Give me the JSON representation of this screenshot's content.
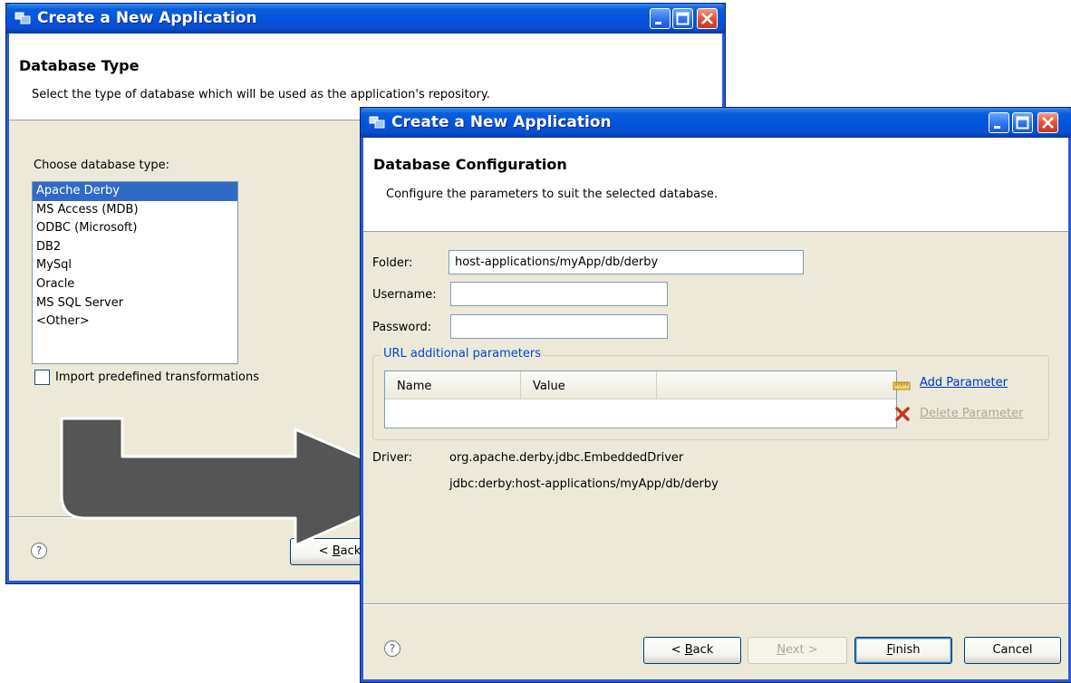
{
  "back_window": {
    "title": "Create a New Application",
    "header_title": "Database Type",
    "header_desc": "Select the type of database which will be used as the application's repository.",
    "choose_label": "Choose database type:",
    "db_types": [
      "Apache Derby",
      "MS Access (MDB)",
      "ODBC (Microsoft)",
      "DB2",
      "MySql",
      "Oracle",
      "MS SQL Server",
      "<Other>"
    ],
    "selected_index": 0,
    "import_checkbox_label": "Import predefined transformations",
    "back_button": {
      "mnemonic": "B",
      "rest": "ack",
      "prefix": "< "
    }
  },
  "front_window": {
    "title": "Create a New Application",
    "header_title": "Database Configuration",
    "header_desc": "Configure the parameters to suit the selected database.",
    "folder_label": "Folder:",
    "folder_value": "host-applications/myApp/db/derby",
    "username_label": "Username:",
    "username_value": "",
    "password_label": "Password:",
    "password_value": "",
    "url_group_title": "URL additional parameters",
    "table_columns": [
      "Name",
      "Value"
    ],
    "add_parameter": "Add Parameter",
    "delete_parameter": "Delete Parameter",
    "driver_label": "Driver:",
    "driver_value": "org.apache.derby.jdbc.EmbeddedDriver",
    "url_value": "jdbc:derby:host-applications/myApp/db/derby",
    "buttons": {
      "back_prefix": "< ",
      "back_mnemonic": "B",
      "back_rest": "ack",
      "next_prefix": "",
      "next_mnemonic": "N",
      "next_rest": "ext >",
      "finish_prefix": "",
      "finish_mnemonic": "F",
      "finish_rest": "inish",
      "cancel": "Cancel"
    }
  },
  "help_glyph": "?",
  "colors": {
    "title_bar": "#0354de",
    "dialog_bg": "#ece9d8",
    "selection": "#316ac5",
    "link": "#0033cc",
    "arrow": "#555555"
  }
}
